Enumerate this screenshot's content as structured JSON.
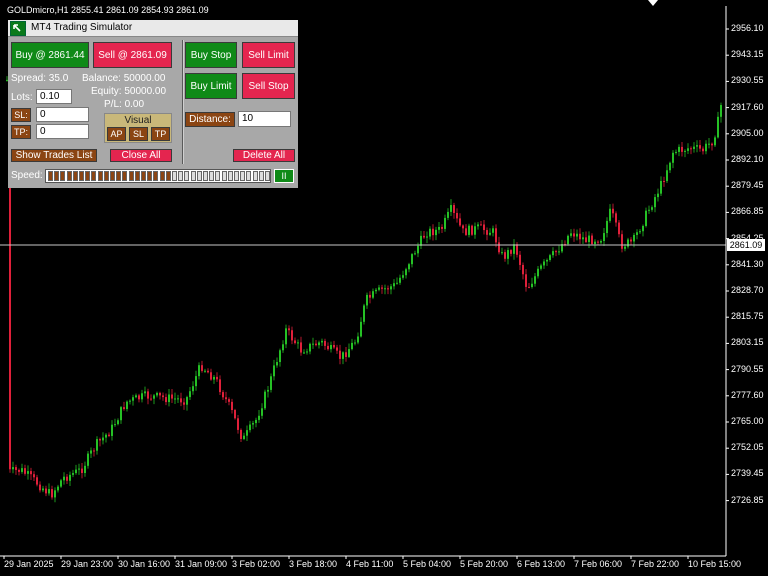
{
  "header": {
    "symbol_info": "GOLDmicro,H1  2855.41 2861.09 2854.93 2861.09"
  },
  "panel": {
    "title": "MT4 Trading Simulator",
    "buy_market": "Buy @ 2861.44",
    "sell_market": "Sell @ 2861.09",
    "buy_stop": "Buy Stop",
    "sell_limit": "Sell Limit",
    "buy_limit": "Buy Limit",
    "sell_stop": "Sell Stop",
    "spread": "Spread: 35.0",
    "balance": "Balance: 50000.00",
    "equity": "Equity: 50000.00",
    "pl": "P/L: 0.00",
    "lots_label": "Lots:",
    "lots_value": "0.10",
    "sl_label": "SL:",
    "sl_value": "0",
    "tp_label": "TP:",
    "tp_value": "0",
    "visual_title": "Visual",
    "visual_ap": "AP",
    "visual_sl": "SL",
    "visual_tp": "TP",
    "distance_label": "Distance:",
    "distance_value": "10",
    "show_trades": "Show Trades List",
    "close_all": "Close All",
    "delete_all": "Delete All",
    "speed_label": "Speed:",
    "speed_level": 0.55,
    "pause_label": "II"
  },
  "axes": {
    "price_ticks": [
      "2956.10",
      "2943.15",
      "2930.55",
      "2917.60",
      "2905.00",
      "2892.10",
      "2879.45",
      "2866.85",
      "2854.25",
      "2841.30",
      "2828.70",
      "2815.75",
      "2803.15",
      "2790.55",
      "2777.60",
      "2765.00",
      "2752.05",
      "2739.45",
      "2726.85"
    ],
    "time_ticks": [
      "29 Jan 2025",
      "29 Jan 23:00",
      "30 Jan 16:00",
      "31 Jan 09:00",
      "3 Feb 02:00",
      "3 Feb 18:00",
      "4 Feb 11:00",
      "5 Feb 04:00",
      "5 Feb 20:00",
      "6 Feb 13:00",
      "7 Feb 06:00",
      "7 Feb 22:00",
      "10 Feb 15:00"
    ],
    "current_price": "2861.09"
  },
  "colors": {
    "bull": "#25c125",
    "bear": "#e0203a",
    "bg": "#000000",
    "price_line": "#c8c8c8"
  }
}
